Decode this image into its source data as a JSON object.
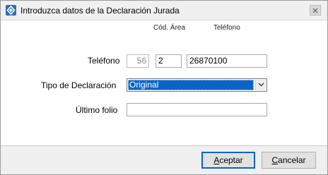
{
  "window": {
    "title": "Introduzca datos de la Declaración Jurada",
    "app_icon": "app-icon",
    "close_icon": "close-icon"
  },
  "form": {
    "phone_area_header": "Cód. Área",
    "phone_number_header": "Teléfono",
    "phone_label": "Teléfono",
    "country_code": "56",
    "area_code": "2",
    "phone_number": "26870100",
    "declaration_type_label": "Tipo de Declaración",
    "declaration_type_value": "Original",
    "last_folio_label": "Último folio",
    "last_folio_value": ""
  },
  "buttons": {
    "accept_mnemonic": "A",
    "accept_rest": "ceptar",
    "cancel_mnemonic": "C",
    "cancel_rest": "ancelar"
  },
  "colors": {
    "accent": "#0a64c8",
    "footer_bg": "#f0f0f0"
  }
}
